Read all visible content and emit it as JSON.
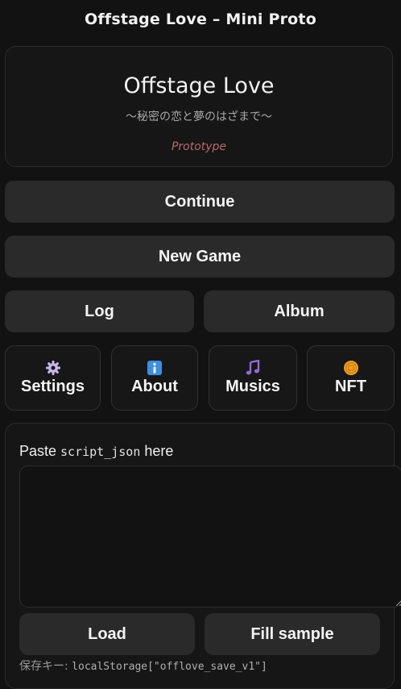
{
  "app": {
    "title": "Offstage Love – Mini Proto"
  },
  "hero": {
    "title": "Offstage Love",
    "subtitle": "〜秘密の恋と夢のはざまで〜",
    "tag": "Prototype"
  },
  "menu": {
    "continue_label": "Continue",
    "new_game_label": "New Game",
    "log_label": "Log",
    "album_label": "Album"
  },
  "tiles": [
    {
      "label": "Settings",
      "icon": "gear-icon"
    },
    {
      "label": "About",
      "icon": "info-icon"
    },
    {
      "label": "Musics",
      "icon": "music-note-icon"
    },
    {
      "label": "NFT",
      "icon": "coin-icon"
    }
  ],
  "script_panel": {
    "label_prefix": "Paste ",
    "label_code": "script_json",
    "label_suffix": " here",
    "textarea_value": "",
    "load_label": "Load",
    "fill_sample_label": "Fill sample",
    "save_key_label": "保存キー: ",
    "save_key_code": "localStorage[\"offlove_save_v1\"]"
  },
  "colors": {
    "background": "#121212",
    "button": "#2a2a2a",
    "prototype_tag": "#b86a70",
    "info_icon": "#3d8fe0",
    "music_icon": "#8a6fd6",
    "coin_icon": "#f0a020"
  }
}
